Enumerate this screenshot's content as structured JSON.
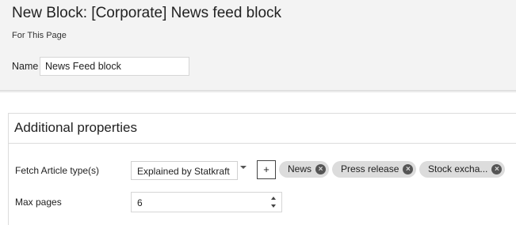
{
  "header": {
    "title": "New Block: [Corporate] News feed block",
    "subtitle": "For This Page",
    "name_label": "Name",
    "name_value": "News Feed block"
  },
  "panel": {
    "title": "Additional properties",
    "fetch": {
      "label": "Fetch Article type(s)",
      "selected": "Explained by Statkraft",
      "add_label": "+",
      "tags": [
        {
          "label": "News",
          "icon": "remove-icon"
        },
        {
          "label": "Press release",
          "icon": "remove-icon"
        },
        {
          "label": "Stock excha...",
          "icon": "remove-icon"
        }
      ]
    },
    "max_pages": {
      "label": "Max pages",
      "value": "6"
    }
  },
  "colors": {
    "header_bg": "#f3f3f3",
    "tag_bg": "#dcdcdc",
    "tag_icon": "#555555"
  }
}
